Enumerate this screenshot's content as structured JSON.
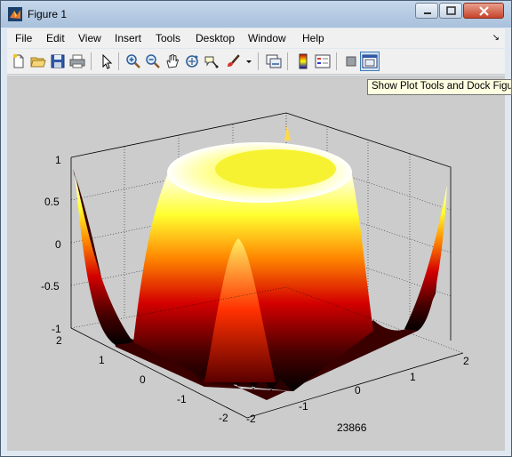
{
  "window": {
    "title": "Figure 1"
  },
  "menu": [
    "File",
    "Edit",
    "View",
    "Insert",
    "Tools",
    "Desktop",
    "Window",
    "Help"
  ],
  "toolbar": {
    "icons": [
      "new-figure-icon",
      "open-file-icon",
      "save-icon",
      "print-icon",
      "edit-plot-icon",
      "zoom-in-icon",
      "zoom-out-icon",
      "pan-icon",
      "rotate-3d-icon",
      "data-cursor-icon",
      "brush-icon",
      "link-plot-icon",
      "colorbar-icon",
      "legend-icon",
      "hide-plot-tools-icon",
      "show-plot-tools-icon"
    ]
  },
  "tooltip": "Show Plot Tools and Dock Figure",
  "chart_data": {
    "type": "surface",
    "colormap": "hot",
    "xlim": [
      -2,
      2
    ],
    "ylim": [
      -2,
      2
    ],
    "zlim": [
      -1,
      1
    ],
    "x_ticks": [
      "-2",
      "-1",
      "0",
      "1",
      "2"
    ],
    "y_ticks": [
      "-2",
      "-1",
      "0",
      "1",
      "2"
    ],
    "z_ticks": [
      "-1",
      "-0.5",
      "0",
      "0.5",
      "1"
    ],
    "xlabel": "23866",
    "grid": true
  }
}
